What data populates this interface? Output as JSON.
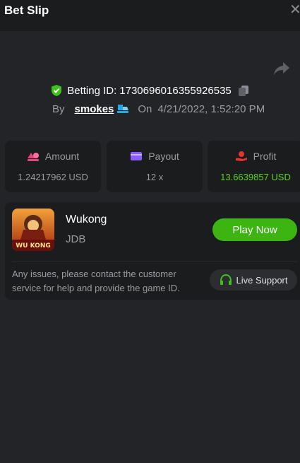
{
  "header": {
    "title": "Bet Slip",
    "close_glyph": "✕"
  },
  "bet": {
    "id_label": "Betting ID:",
    "id_value": "1730696016355926535",
    "by_label": "By",
    "username": "smokes",
    "on_label": "On",
    "datetime": "4/21/2022, 1:52:20 PM"
  },
  "stats": {
    "amount": {
      "label": "Amount",
      "value": "1.24217962 USD"
    },
    "payout": {
      "label": "Payout",
      "value": "12 x"
    },
    "profit": {
      "label": "Profit",
      "value": "13.6639857 USD"
    }
  },
  "game": {
    "name": "Wukong",
    "provider": "JDB",
    "thumb_text": "WU KONG",
    "play_label": "Play Now",
    "support_note": "Any issues, please contact the customer service for help and provide the game ID.",
    "support_label": "Live Support"
  },
  "colors": {
    "accent_green": "#3cb512",
    "profit_green": "#5bd41b",
    "amount_pink": "#e0467a",
    "payout_purple": "#8c5cff",
    "profit_red": "#e8332f"
  }
}
